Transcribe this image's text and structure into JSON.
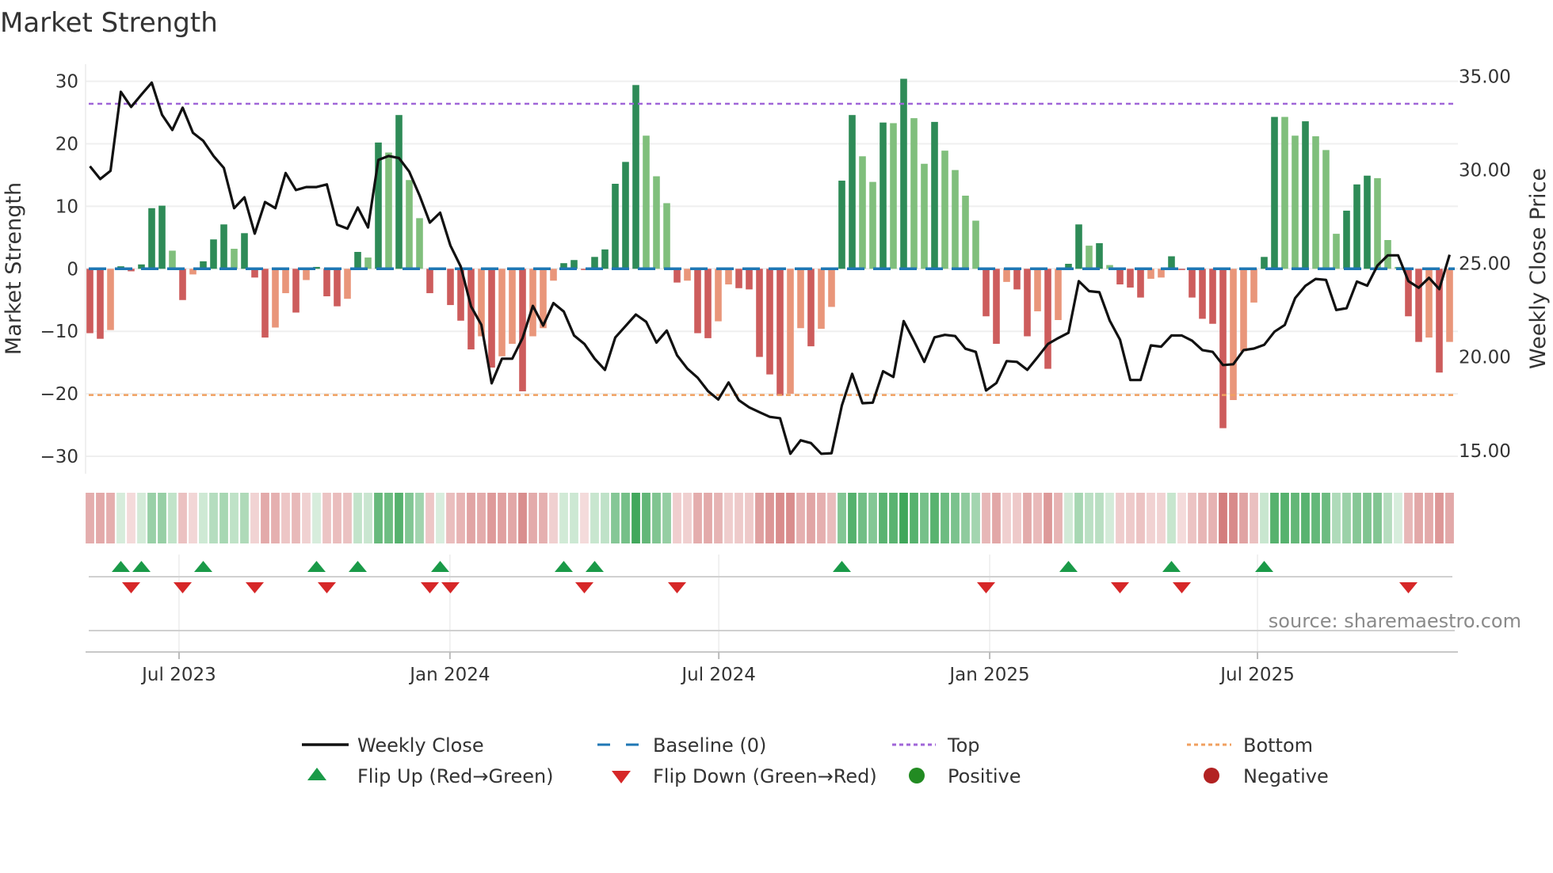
{
  "title": "Market Strength",
  "source": "source: sharemaestro.com",
  "colors": {
    "pos_strong": "#2e8b57",
    "pos_weak": "#80bf7c",
    "neg_strong": "#cd5c5c",
    "neg_weak": "#e9967a",
    "baseline": "#1f77b4",
    "top": "#a066d8",
    "bottom": "#f0a060",
    "price": "#111111",
    "flip_up": "#1a9a48",
    "flip_down": "#d62728",
    "positive": "#228b22",
    "negative": "#b22222"
  },
  "legend": {
    "weekly_close": "Weekly Close",
    "baseline": "Baseline (0)",
    "top": "Top",
    "bottom": "Bottom",
    "flip_up": "Flip Up (Red→Green)",
    "flip_down": "Flip Down (Green→Red)",
    "positive": "Positive",
    "negative": "Negative"
  },
  "chart_data": {
    "type": "bar",
    "title": "Market Strength",
    "ylabel": "Market Strength",
    "y2label": "Weekly Close Price",
    "ylim": [
      -33,
      33
    ],
    "y2lim": [
      13.4,
      36.7
    ],
    "yticks": [
      {
        "v": 30,
        "label": "30"
      },
      {
        "v": 20,
        "label": "20"
      },
      {
        "v": 10,
        "label": "10"
      },
      {
        "v": 0,
        "label": "0"
      },
      {
        "v": -10,
        "label": "−10"
      },
      {
        "v": -20,
        "label": "−20"
      },
      {
        "v": -30,
        "label": "−30"
      }
    ],
    "y2ticks": [
      {
        "v": 35,
        "label": "35.00"
      },
      {
        "v": 30,
        "label": "30.00"
      },
      {
        "v": 25,
        "label": "25.00"
      },
      {
        "v": 20,
        "label": "20.00"
      },
      {
        "v": 15,
        "label": "15.00"
      }
    ],
    "xticks": [
      {
        "week": 9.65,
        "label": "Jul 2023"
      },
      {
        "week": 35.95,
        "label": "Jan 2024"
      },
      {
        "week": 62.05,
        "label": "Jul 2024"
      },
      {
        "week": 88.35,
        "label": "Jan 2025"
      },
      {
        "week": 114.35,
        "label": "Jul 2025"
      }
    ],
    "top_level": 26.4,
    "bottom_level": -20.2,
    "baseline": 0,
    "grid": true,
    "legend_position": "bottom",
    "series": [
      {
        "name": "Market Strength",
        "type": "bar",
        "values": [
          -10.3,
          -11.2,
          -9.8,
          0.4,
          -0.4,
          0.7,
          9.7,
          10.1,
          2.9,
          -5.0,
          -0.9,
          1.2,
          4.7,
          7.1,
          3.2,
          5.7,
          -1.4,
          -11.0,
          -9.4,
          -3.9,
          -7.0,
          -1.8,
          0.3,
          -4.4,
          -6.0,
          -4.8,
          2.7,
          1.8,
          20.2,
          18.6,
          24.6,
          14.2,
          8.1,
          -3.9,
          0.2,
          -5.8,
          -8.3,
          -12.9,
          -10.8,
          -15.8,
          -14.0,
          -12.0,
          -19.6,
          -10.8,
          -9.5,
          -1.9,
          0.9,
          1.4,
          -0.2,
          1.9,
          3.1,
          13.6,
          17.1,
          29.4,
          21.3,
          14.8,
          10.5,
          -2.2,
          -1.9,
          -10.3,
          -11.1,
          -8.4,
          -2.5,
          -3.1,
          -3.3,
          -14.1,
          -16.9,
          -20.3,
          -20.0,
          -9.5,
          -12.4,
          -9.6,
          -6.1,
          14.1,
          24.6,
          18.0,
          13.9,
          23.4,
          23.3,
          30.4,
          24.1,
          16.8,
          23.5,
          18.9,
          15.8,
          11.7,
          7.7,
          -7.6,
          -12.0,
          -2.1,
          -3.3,
          -10.8,
          -6.8,
          -16.0,
          -8.2,
          0.8,
          7.1,
          3.7,
          4.1,
          0.6,
          -2.5,
          -3.0,
          -4.6,
          -1.6,
          -1.4,
          2.0,
          -0.2,
          -4.6,
          -8.0,
          -8.8,
          -25.5,
          -21.0,
          -13.2,
          -5.4,
          1.9,
          24.3,
          24.3,
          21.3,
          23.6,
          21.2,
          19.0,
          5.6,
          9.3,
          13.5,
          14.9,
          14.5,
          4.6,
          0.3,
          -7.6,
          -11.7,
          -11.0,
          -16.6,
          -11.7
        ]
      },
      {
        "name": "Weekly Close",
        "type": "line",
        "axis": "right",
        "values": [
          30.19,
          29.51,
          29.95,
          34.17,
          33.36,
          34.02,
          34.66,
          32.94,
          32.13,
          33.32,
          31.98,
          31.55,
          30.74,
          30.1,
          27.95,
          28.53,
          26.59,
          28.28,
          27.95,
          29.83,
          28.92,
          29.08,
          29.08,
          29.22,
          27.07,
          26.86,
          27.99,
          26.92,
          30.53,
          30.74,
          30.63,
          29.9,
          28.63,
          27.18,
          27.71,
          25.95,
          24.83,
          22.7,
          21.72,
          18.59,
          19.91,
          19.91,
          21.01,
          22.73,
          21.68,
          22.88,
          22.43,
          21.15,
          20.7,
          19.91,
          19.31,
          21.04,
          21.65,
          22.27,
          21.88,
          20.77,
          21.41,
          20.09,
          19.38,
          18.89,
          18.18,
          17.73,
          18.64,
          17.69,
          17.31,
          17.05,
          16.8,
          16.73,
          14.83,
          15.55,
          15.4,
          14.83,
          14.86,
          17.41,
          19.1,
          17.53,
          17.56,
          19.24,
          18.93,
          21.92,
          20.86,
          19.74,
          21.05,
          21.18,
          21.12,
          20.44,
          20.27,
          18.21,
          18.61,
          19.78,
          19.74,
          19.31,
          19.99,
          20.69,
          21.01,
          21.29,
          24.05,
          23.52,
          23.46,
          21.95,
          20.93,
          18.77,
          18.77,
          20.62,
          20.55,
          21.15,
          21.15,
          20.87,
          20.37,
          20.27,
          19.57,
          19.61,
          20.37,
          20.45,
          20.65,
          21.35,
          21.71,
          23.14,
          23.8,
          24.17,
          24.12,
          22.51,
          22.61,
          24.03,
          23.81,
          24.89,
          25.43,
          25.43,
          24.05,
          23.7,
          24.23,
          23.63,
          25.46
        ]
      }
    ]
  }
}
